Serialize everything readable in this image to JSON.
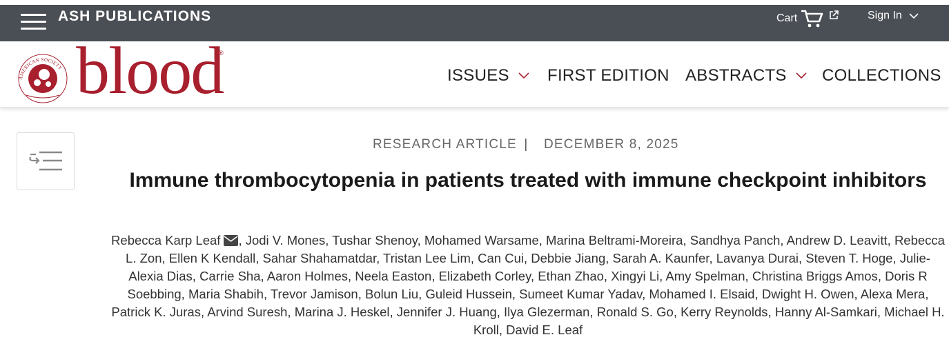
{
  "topbar": {
    "brand": "ASH PUBLICATIONS",
    "cart_label": "Cart",
    "signin_label": "Sign In",
    "icons": [
      "menu-icon",
      "cart-icon",
      "external-link-icon",
      "chevron-down-icon"
    ]
  },
  "logo": {
    "wordmark": "blood",
    "seal_text": "AMERICAN SOCIETY OF HEMATOLOGY",
    "reg_mark": "®"
  },
  "nav": {
    "items": [
      {
        "label": "ISSUES",
        "dropdown": true
      },
      {
        "label": "FIRST EDITION",
        "dropdown": false
      },
      {
        "label": "ABSTRACTS",
        "dropdown": true
      },
      {
        "label": "COLLECTIONS",
        "dropdown": true
      }
    ]
  },
  "article": {
    "type": "RESEARCH ARTICLE",
    "separator": "|",
    "date": "DECEMBER 8, 2025",
    "title": "Immune thrombocytopenia in patients treated with immune checkpoint inhibitors",
    "authors": [
      "Rebecca Karp Leaf",
      "Jodi V. Mones",
      "Tushar Shenoy",
      "Mohamed Warsame",
      "Marina Beltrami-Moreira",
      "Sandhya Panch",
      "Andrew D. Leavitt",
      "Rebecca L. Zon",
      "Ellen K Kendall",
      "Sahar Shahamatdar",
      "Tristan Lee Lim",
      "Can Cui",
      "Debbie Jiang",
      "Sarah A. Kaunfer",
      "Lavanya Durai",
      "Steven T. Hoge",
      "Julie-Alexia Dias",
      "Carrie Sha",
      "Aaron Holmes",
      "Neela Easton",
      "Elizabeth Corley",
      "Ethan Zhao",
      "Xingyi Li",
      "Amy Spelman",
      "Christina Briggs Amos",
      "Doris R Soebbing",
      "Maria Shabih",
      "Trevor Jamison",
      "Bolun Liu",
      "Guleid Hussein",
      "Sumeet Kumar Yadav",
      "Mohamed I. Elsaid",
      "Dwight H. Owen",
      "Alexa Mera",
      "Patrick K. Juras",
      "Arvind Suresh",
      "Marina J. Heskel",
      "Jennifer J. Huang",
      "Ilya Glezerman",
      "Ronald S. Go",
      "Kerry Reynolds",
      "Hanny Al-Samkari",
      "Michael H. Kroll",
      "David E. Leaf"
    ],
    "corresponding_icon": "envelope-icon"
  },
  "colors": {
    "topbar": "#4a4e55",
    "brand_red": "#a81f2e",
    "meta_gray": "#666666"
  }
}
